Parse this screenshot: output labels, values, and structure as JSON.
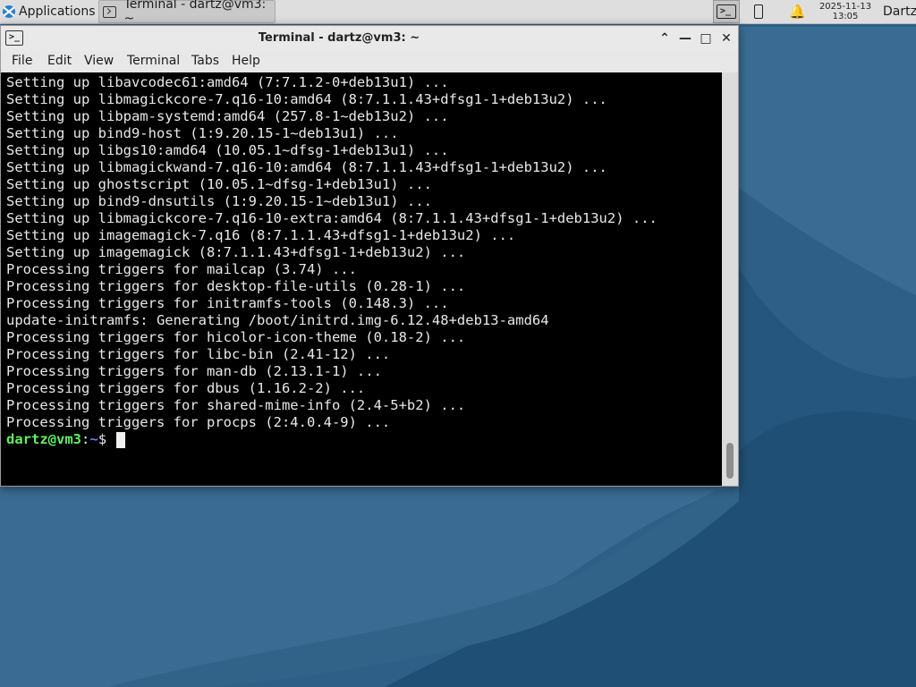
{
  "panel": {
    "apps_label": "Applications",
    "task_label": "Terminal - dartz@vm3: ~",
    "clock_date": "2025-11-13",
    "clock_time": "13:05",
    "user": "Dartz",
    "tray_terminal_glyph": ">_"
  },
  "window": {
    "title": "Terminal - dartz@vm3: ~",
    "icon_glyph": ">_",
    "controls": {
      "shade": "⌃",
      "minimize": "—",
      "maximize": "□",
      "close": "✕"
    }
  },
  "menu": {
    "file": "File",
    "edit": "Edit",
    "view": "View",
    "terminal": "Terminal",
    "tabs": "Tabs",
    "help": "Help"
  },
  "terminal": {
    "output": "Setting up libavcodec61:amd64 (7:7.1.2-0+deb13u1) ...\nSetting up libmagickcore-7.q16-10:amd64 (8:7.1.1.43+dfsg1-1+deb13u2) ...\nSetting up libpam-systemd:amd64 (257.8-1~deb13u2) ...\nSetting up bind9-host (1:9.20.15-1~deb13u1) ...\nSetting up libgs10:amd64 (10.05.1~dfsg-1+deb13u1) ...\nSetting up libmagickwand-7.q16-10:amd64 (8:7.1.1.43+dfsg1-1+deb13u2) ...\nSetting up ghostscript (10.05.1~dfsg-1+deb13u1) ...\nSetting up bind9-dnsutils (1:9.20.15-1~deb13u1) ...\nSetting up libmagickcore-7.q16-10-extra:amd64 (8:7.1.1.43+dfsg1-1+deb13u2) ...\nSetting up imagemagick-7.q16 (8:7.1.1.43+dfsg1-1+deb13u2) ...\nSetting up imagemagick (8:7.1.1.43+dfsg1-1+deb13u2) ...\nProcessing triggers for mailcap (3.74) ...\nProcessing triggers for desktop-file-utils (0.28-1) ...\nProcessing triggers for initramfs-tools (0.148.3) ...\nupdate-initramfs: Generating /boot/initrd.img-6.12.48+deb13-amd64\nProcessing triggers for hicolor-icon-theme (0.18-2) ...\nProcessing triggers for libc-bin (2.41-12) ...\nProcessing triggers for man-db (2.13.1-1) ...\nProcessing triggers for dbus (1.16.2-2) ...\nProcessing triggers for shared-mime-info (2.4-5+b2) ...\nProcessing triggers for procps (2:4.0.4-9) ...",
    "prompt_user": "dartz@vm3",
    "prompt_colon": ":",
    "prompt_path": "~",
    "prompt_dollar": "$ "
  },
  "colors": {
    "prompt_user": "#5ff05f",
    "prompt_path": "#6d7cff",
    "terminal_bg": "#000000",
    "wallpaper": "#2e5f86"
  }
}
